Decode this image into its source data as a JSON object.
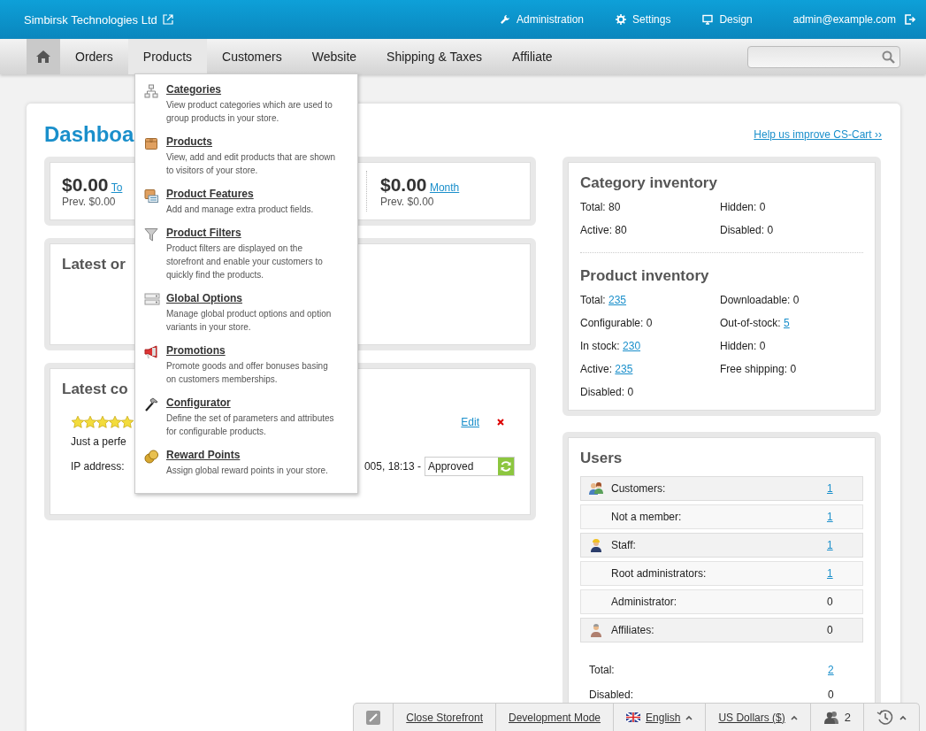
{
  "header": {
    "company": "Simbirsk Technologies Ltd",
    "links": [
      {
        "label": "Administration",
        "kind": "wrench"
      },
      {
        "label": "Settings",
        "kind": "gear"
      },
      {
        "label": "Design",
        "kind": "monitor"
      }
    ],
    "user": "admin@example.com"
  },
  "nav": {
    "items": [
      {
        "label": "Orders",
        "selected": false
      },
      {
        "label": "Products",
        "selected": true
      },
      {
        "label": "Customers",
        "selected": false
      },
      {
        "label": "Website",
        "selected": false
      },
      {
        "label": "Shipping & Taxes",
        "selected": false
      },
      {
        "label": "Affiliate",
        "selected": false
      }
    ]
  },
  "menu": [
    {
      "title": "Categories",
      "description": "View product categories which are used to group products in your store.",
      "kind": "tree"
    },
    {
      "title": "Products",
      "description": "View, add and edit products that are shown to visitors of your store.",
      "kind": "box"
    },
    {
      "title": "Product Features",
      "description": "Add and manage extra product fields.",
      "kind": "features"
    },
    {
      "title": "Product Filters",
      "description": "Product filters are displayed on the storefront and enable your customers to quickly find the products.",
      "kind": "funnel"
    },
    {
      "title": "Global Options",
      "description": "Manage global product options and option variants in your store.",
      "kind": "options"
    },
    {
      "title": "Promotions",
      "description": "Promote goods and offer bonuses basing on customers memberships.",
      "kind": "megaphone"
    },
    {
      "title": "Configurator",
      "description": "Define the set of parameters and attributes for configurable products.",
      "kind": "hammer"
    },
    {
      "title": "Reward Points",
      "description": "Assign global reward points in your store.",
      "kind": "coins"
    }
  ],
  "dashboard": {
    "title": "Dashboa",
    "help_link": "Help us improve CS-Cart ››"
  },
  "sales": [
    {
      "amount": "$0.00",
      "period": "To",
      "prev": "Prev. $0.00"
    },
    {
      "amount": "$0.00",
      "period": "Month",
      "prev": "Prev. $0.00"
    }
  ],
  "latest_orders": {
    "title": "Latest or"
  },
  "latest_comments": {
    "title": "Latest co",
    "stars": 5,
    "text": "Just a perfe",
    "edit": "Edit",
    "ip_label": "IP address:",
    "date": "005, 18:13 -",
    "status": "Approved"
  },
  "category_inventory": {
    "title": "Category inventory",
    "stats": [
      {
        "label": "Total:",
        "value": "80",
        "link": false
      },
      {
        "label": "Hidden:",
        "value": "0",
        "link": false
      },
      {
        "label": "Active:",
        "value": "80",
        "link": false
      },
      {
        "label": "Disabled:",
        "value": "0",
        "link": false
      }
    ]
  },
  "product_inventory": {
    "title": "Product inventory",
    "stats": [
      {
        "label": "Total:",
        "value": "235",
        "link": true
      },
      {
        "label": "Downloadable:",
        "value": "0",
        "link": false
      },
      {
        "label": "Configurable:",
        "value": "0",
        "link": false
      },
      {
        "label": "Out-of-stock:",
        "value": "5",
        "link": true
      },
      {
        "label": "In stock:",
        "value": "230",
        "link": true
      },
      {
        "label": "Hidden:",
        "value": "0",
        "link": false
      },
      {
        "label": "Active:",
        "value": "235",
        "link": true
      },
      {
        "label": "Free shipping:",
        "value": "0",
        "link": false
      },
      {
        "label": "Disabled:",
        "value": "0",
        "link": false
      }
    ]
  },
  "users": {
    "title": "Users",
    "rows": [
      {
        "kind": "customers",
        "label": "Customers:",
        "value": "1",
        "link": true
      },
      {
        "kind": "sub",
        "label": "Not a member:",
        "value": "1",
        "link": true
      },
      {
        "kind": "staff",
        "label": "Staff:",
        "value": "1",
        "link": true
      },
      {
        "kind": "sub",
        "label": "Root administrators:",
        "value": "1",
        "link": true
      },
      {
        "kind": "sub",
        "label": "Administrator:",
        "value": "0",
        "link": false
      },
      {
        "kind": "affiliates",
        "label": "Affiliates:",
        "value": "0",
        "link": false
      }
    ],
    "totals": [
      {
        "label": "Total:",
        "value": "2",
        "link": true
      },
      {
        "label": "Disabled:",
        "value": "0",
        "link": false
      }
    ]
  },
  "bottom_bar": {
    "close_storefront": "Close Storefront",
    "mode": "Development Mode",
    "language": "English",
    "currency": "US Dollars ($)",
    "online": "2"
  }
}
